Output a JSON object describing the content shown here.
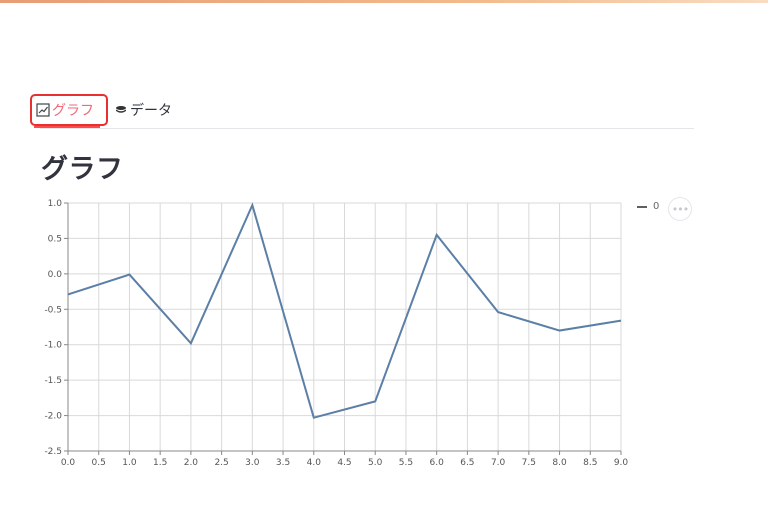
{
  "tabs": [
    {
      "label": "グラフ",
      "icon": "line-chart-icon",
      "selected": true
    },
    {
      "label": "データ",
      "icon": "database-icon",
      "selected": false
    }
  ],
  "page_title": "グラフ",
  "chart_menu_icon": "more-horizontal-icon",
  "colors": {
    "line": "#5b7fa6",
    "grid": "#d9d9d9",
    "tab_selected": "#ff4b4b",
    "highlight_border": "#e8312f"
  },
  "chart_data": {
    "type": "line",
    "x": [
      0,
      1,
      2,
      3,
      4,
      5,
      6,
      7,
      8,
      9
    ],
    "series": [
      {
        "name": "0",
        "values": [
          -0.29,
          -0.01,
          -0.98,
          0.97,
          -2.03,
          -1.8,
          0.55,
          -0.54,
          -0.8,
          -0.66
        ]
      }
    ],
    "xlim": [
      0,
      9
    ],
    "ylim": [
      -2.5,
      1.0
    ],
    "xticks": [
      "0.0",
      "0.5",
      "1.0",
      "1.5",
      "2.0",
      "2.5",
      "3.0",
      "3.5",
      "4.0",
      "4.5",
      "5.0",
      "5.5",
      "6.0",
      "6.5",
      "7.0",
      "7.5",
      "8.0",
      "8.5",
      "9.0"
    ],
    "yticks": [
      "1.0",
      "0.5",
      "0.0",
      "-0.5",
      "-1.0",
      "-1.5",
      "-2.0",
      "-2.5"
    ],
    "grid": true,
    "legend": "right"
  }
}
